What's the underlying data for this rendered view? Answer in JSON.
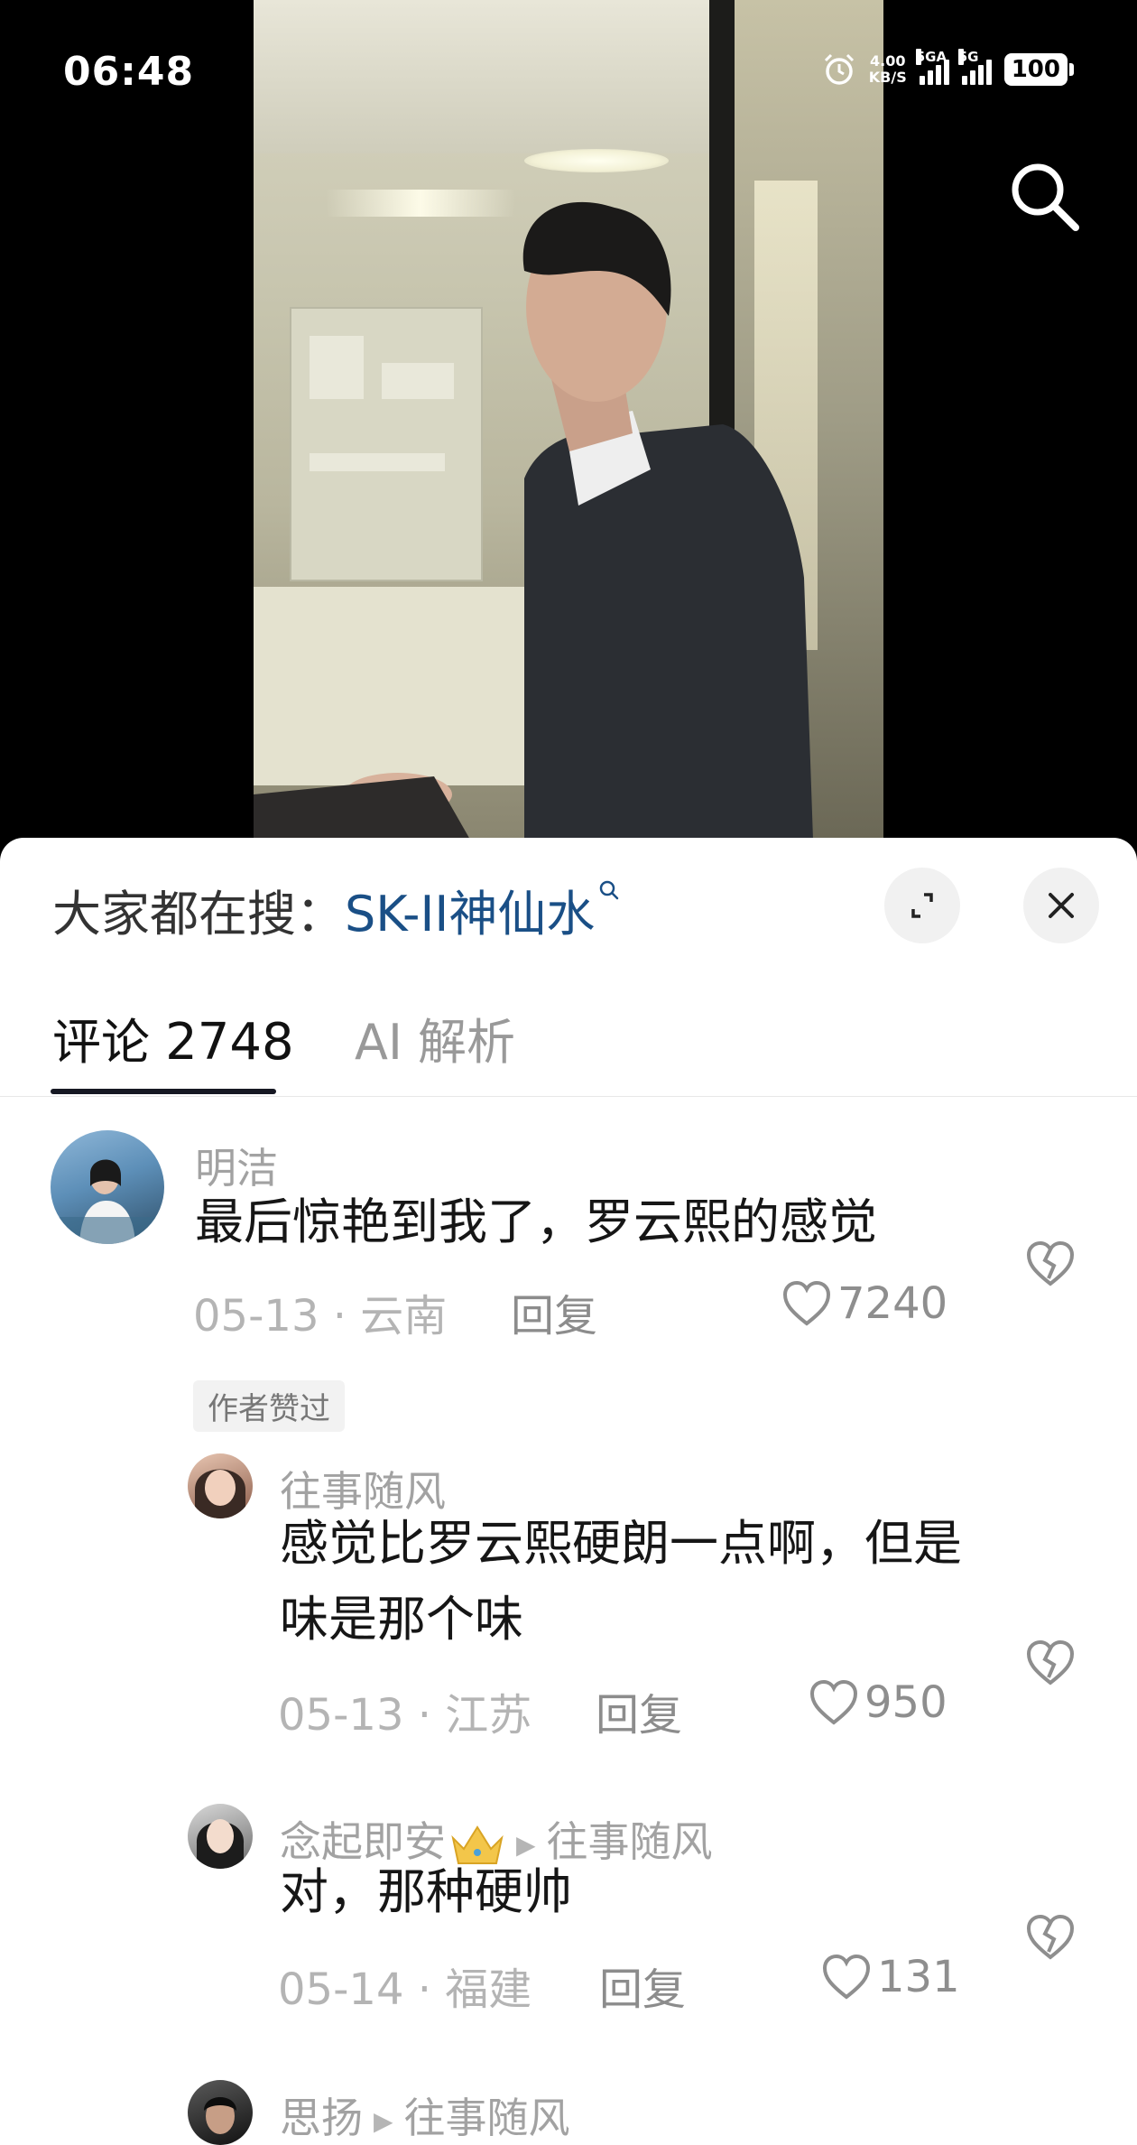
{
  "status_bar": {
    "time": "06:48",
    "net_speed_top": "4.00",
    "net_speed_bottom": "KB/S",
    "sig1_label": "5GA",
    "sig2_label": "5G",
    "battery": "100"
  },
  "search_suggest": {
    "prefix": "大家都在搜：",
    "keyword": "SK-II神仙水"
  },
  "tabs": {
    "comments_label": "评论",
    "comments_count": "2748",
    "ai_label": "AI 解析"
  },
  "comments": [
    {
      "user": "明洁",
      "text": "最后惊艳到我了，罗云熙的感觉",
      "date_loc": "05-13 · 云南",
      "reply": "回复",
      "likes": "7240",
      "badge": "作者赞过"
    },
    {
      "user": "往事随风",
      "text_line1": "感觉比罗云熙硬朗一点啊，但是",
      "text_line2": "味是那个味",
      "date_loc": "05-13 · 江苏",
      "reply": "回复",
      "likes": "950"
    },
    {
      "user": "念起即安",
      "reply_to": "往事随风",
      "text": "对，那种硬帅",
      "date_loc": "05-14 · 福建",
      "reply": "回复",
      "likes": "131"
    },
    {
      "user": "思扬",
      "reply_to": "往事随风"
    }
  ],
  "icons": {
    "search": "search-icon",
    "expand": "expand-icon",
    "close": "close-icon",
    "like": "heart-icon",
    "dislike": "broken-heart-icon",
    "crown": "crown-icon",
    "alarm": "alarm-icon"
  },
  "colors": {
    "keyword": "#1a4f86",
    "tab_underline": "#161823",
    "muted": "#a2a2a2"
  }
}
